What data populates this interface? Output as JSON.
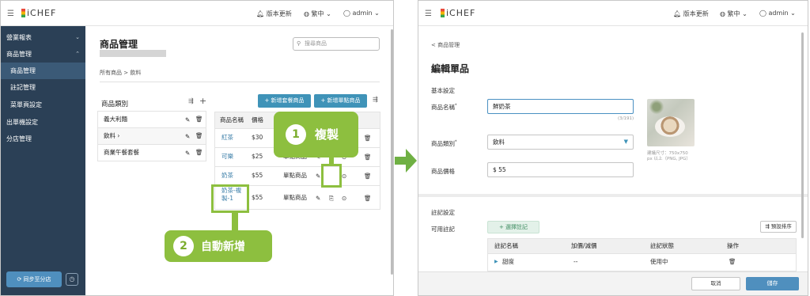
{
  "header": {
    "brand": "iCHEF",
    "version_update": "版本更新",
    "language": "繁中",
    "user": "admin"
  },
  "sidebar": {
    "items": [
      {
        "label": "營業報表"
      },
      {
        "label": "商品管理"
      },
      {
        "label": "商品管理"
      },
      {
        "label": "註記管理"
      },
      {
        "label": "菜單頁設定"
      },
      {
        "label": "出單機設定"
      },
      {
        "label": "分店管理"
      }
    ],
    "sync_button": "同步至分店"
  },
  "left_page": {
    "title": "商品管理",
    "search_placeholder": "搜尋商品",
    "breadcrumb": [
      "所有商品",
      ">",
      "飲料"
    ],
    "category_header": "商品類別",
    "categories": [
      "義大利麵",
      "飲料",
      "商業午餐套餐"
    ],
    "add_combo_button": "+ 新增套餐商品",
    "add_single_button": "+ 新增單點商品",
    "table_headers": [
      "商品名稱",
      "價格"
    ],
    "rows": [
      {
        "name": "紅茶",
        "price": "$30",
        "type": ""
      },
      {
        "name": "可樂",
        "price": "$25",
        "type": "單點商品"
      },
      {
        "name": "奶茶",
        "price": "$55",
        "type": "單點商品"
      },
      {
        "name": "奶茶-複製-1",
        "name_line1": "奶茶-複",
        "name_line2": "製-1",
        "price": "$55",
        "type": "單點商品"
      }
    ],
    "callout_copy": {
      "number": "1",
      "label": "複製"
    },
    "callout_auto": {
      "number": "2",
      "label": "自動新增"
    }
  },
  "right_page": {
    "back": "< 商品管理",
    "title": "編輯單品",
    "section_basic": "基本設定",
    "name_label": "商品名稱",
    "name_value": "鮮奶茶",
    "char_count": "(3/191)",
    "category_label": "商品類別",
    "category_value": "飲料",
    "price_label": "商品價格",
    "price_value": "$ 55",
    "image_hint_1": "建議尺寸：750x750",
    "image_hint_2": "px 以上（PNG, JPG）",
    "section_note": "註記設定",
    "available_notes_label": "可用註記",
    "select_note_button": "+ 選擇註記",
    "preset_sort_button": "預設排序",
    "note_headers": [
      "註記名稱",
      "加價/減價",
      "註記狀態",
      "操作"
    ],
    "note_rows": [
      {
        "name": "甜度",
        "price": "--",
        "status": "使用中"
      }
    ],
    "cancel_button": "取消",
    "save_button": "儲存"
  },
  "colors": {
    "sidebar_bg": "#2b4056",
    "sidebar_active": "#3b5a77",
    "accent_blue": "#3f93b8",
    "callout_green": "#8dbf3f",
    "arrow_green": "#6fb043",
    "save_blue": "#4f8fbe"
  }
}
